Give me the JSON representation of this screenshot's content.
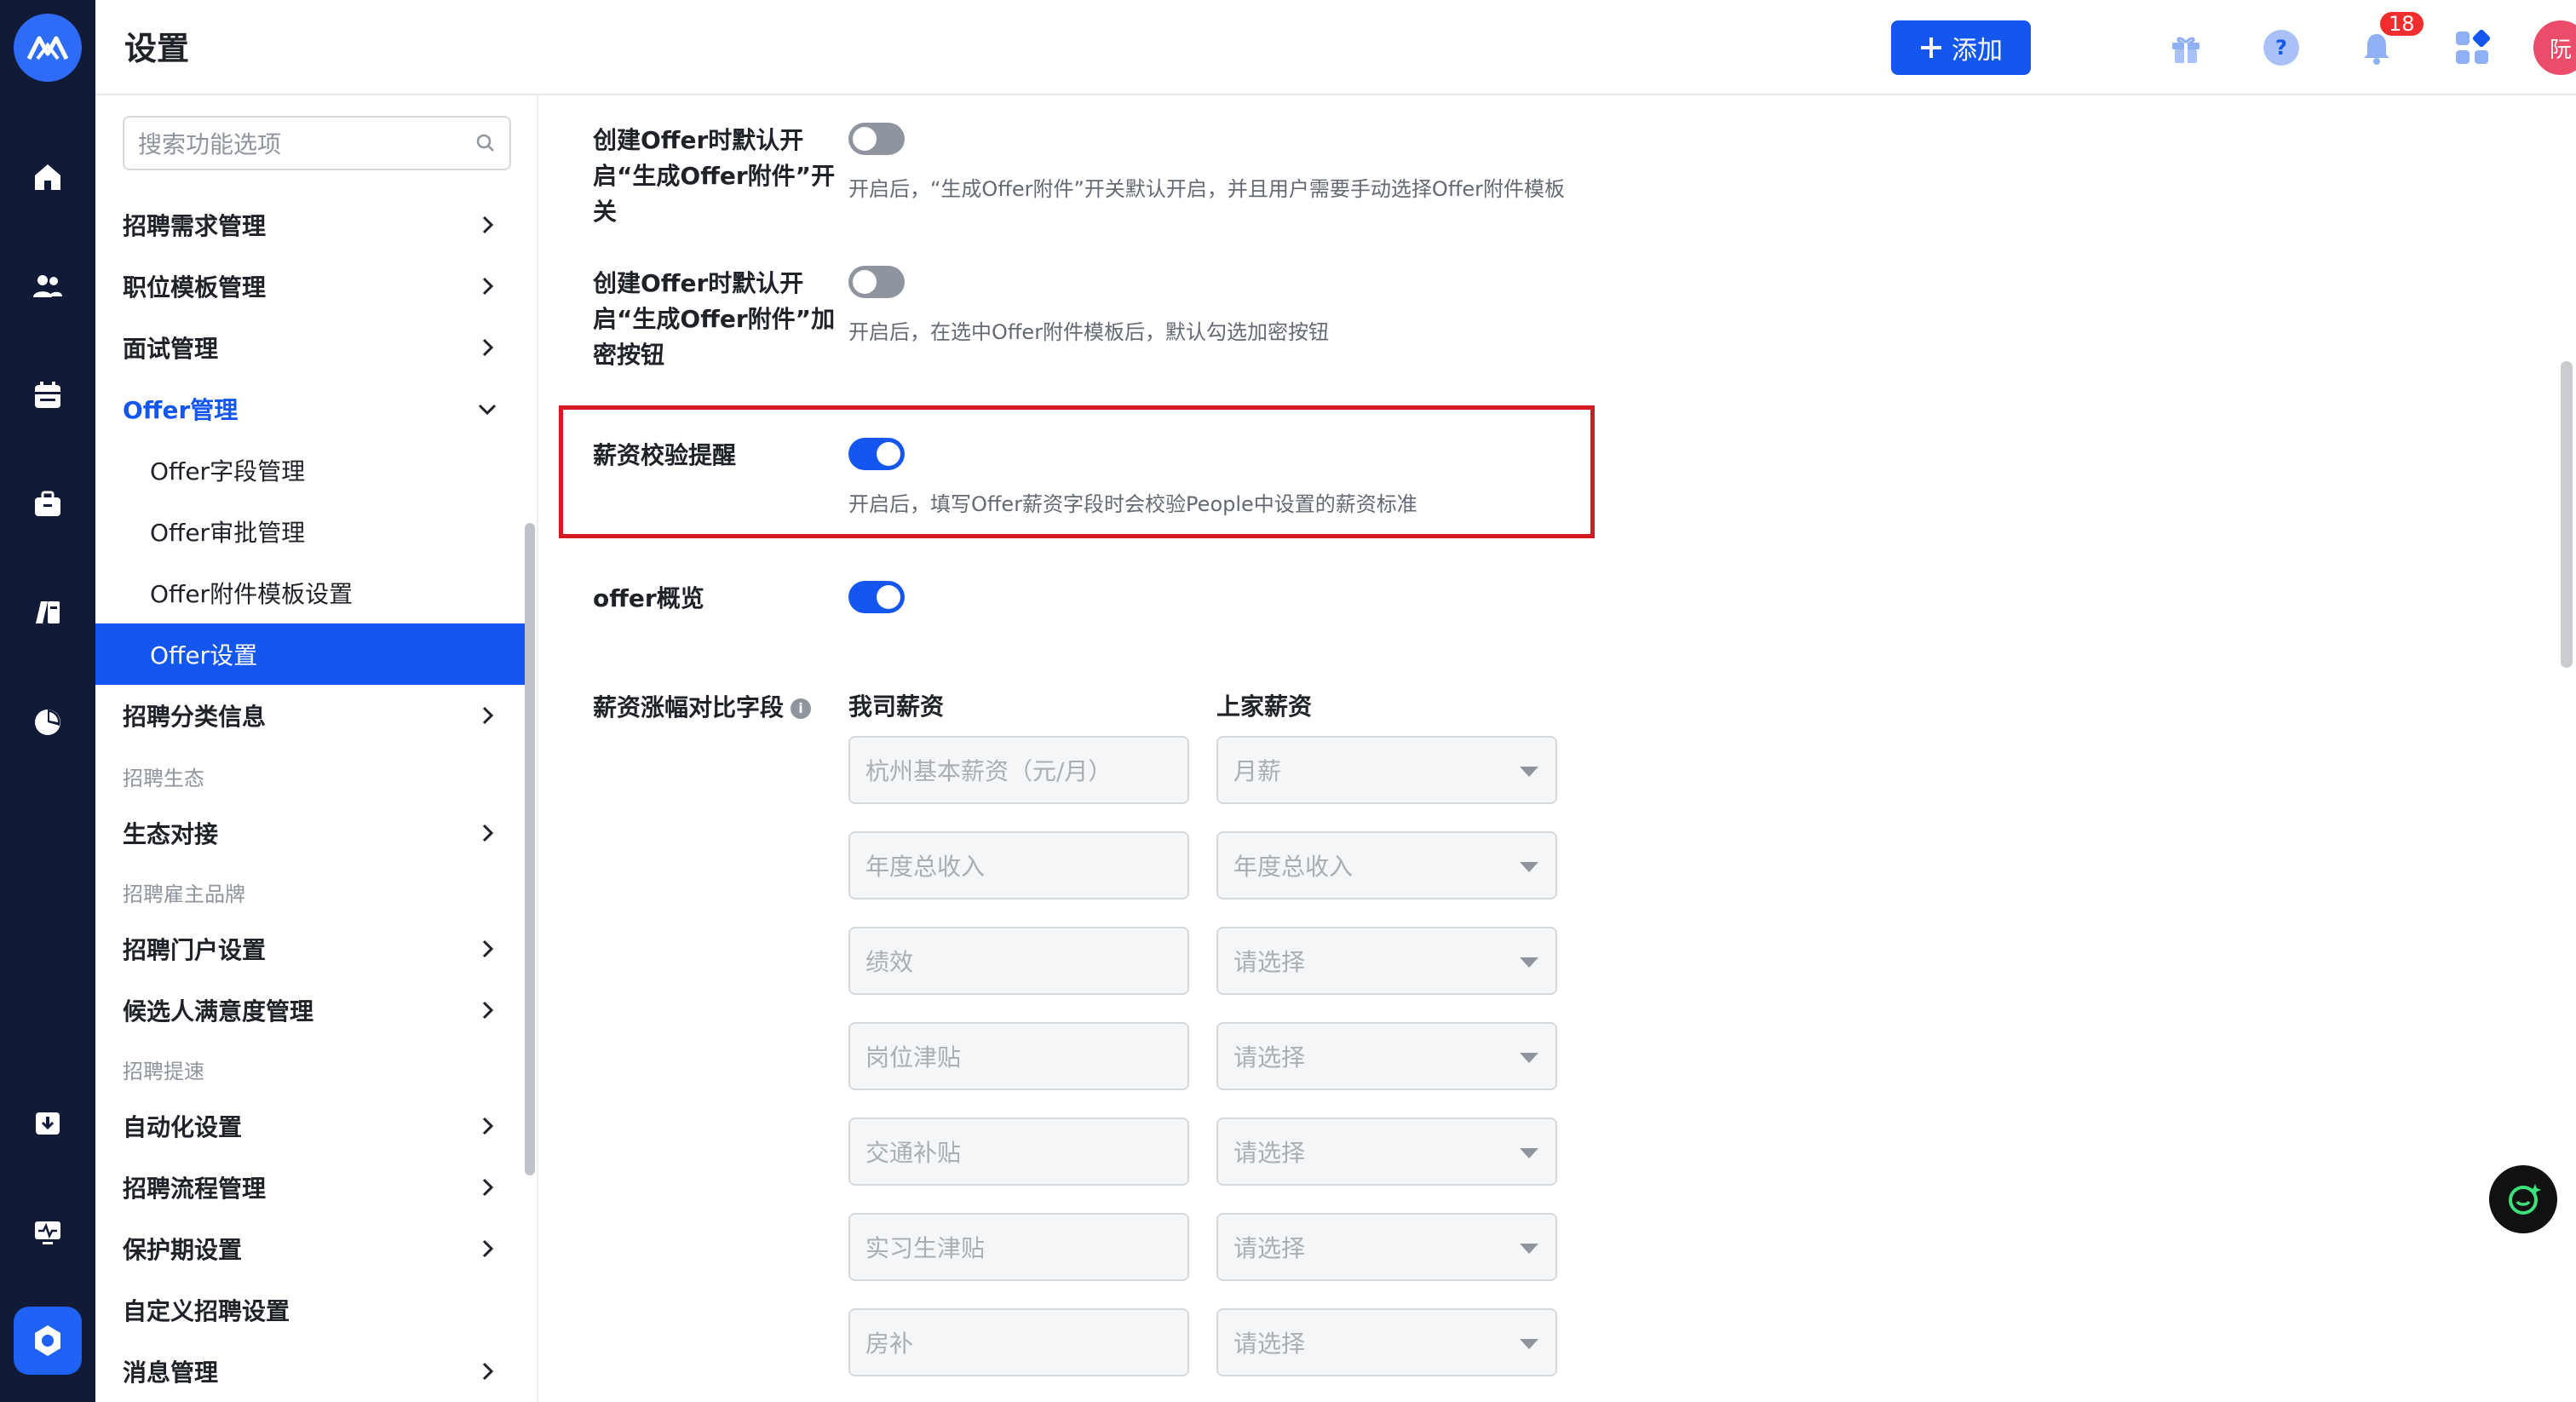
{
  "header": {
    "title": "设置",
    "add_label": "添加",
    "notification_count": "18",
    "avatar_text": "阮"
  },
  "sidebar": {
    "search_placeholder": "搜索功能选项",
    "items": [
      {
        "label": "招聘需求管理"
      },
      {
        "label": "职位模板管理"
      },
      {
        "label": "面试管理"
      },
      {
        "label": "Offer管理"
      },
      {
        "label": "Offer字段管理"
      },
      {
        "label": "Offer审批管理"
      },
      {
        "label": "Offer附件模板设置"
      },
      {
        "label": "Offer设置"
      },
      {
        "label": "招聘分类信息"
      },
      {
        "label": "招聘生态"
      },
      {
        "label": "生态对接"
      },
      {
        "label": "招聘雇主品牌"
      },
      {
        "label": "招聘门户设置"
      },
      {
        "label": "候选人满意度管理"
      },
      {
        "label": "招聘提速"
      },
      {
        "label": "自动化设置"
      },
      {
        "label": "招聘流程管理"
      },
      {
        "label": "保护期设置"
      },
      {
        "label": "自定义招聘设置"
      },
      {
        "label": "消息管理"
      }
    ]
  },
  "settings": [
    {
      "label": "创建Offer时默认开启“生成Offer附件”开关",
      "desc": "开启后，“生成Offer附件”开关默认开启，并且用户需要手动选择Offer附件模板",
      "on": false
    },
    {
      "label": "创建Offer时默认开启“生成Offer附件”加密按钮",
      "desc": "开启后，在选中Offer附件模板后，默认勾选加密按钮",
      "on": false
    },
    {
      "label": "薪资校验提醒",
      "desc": "开启后，填写Offer薪资字段时会校验People中设置的薪资标准",
      "on": true
    },
    {
      "label": "offer概览",
      "desc": "",
      "on": true
    }
  ],
  "salary_compare": {
    "label": "薪资涨幅对比字段",
    "our_col": "我司薪资",
    "prev_col": "上家薪资",
    "rows": [
      {
        "ours": "杭州基本薪资（元/月）",
        "prev": "月薪"
      },
      {
        "ours": "年度总收入",
        "prev": "年度总收入"
      },
      {
        "ours": "绩效",
        "prev": "请选择"
      },
      {
        "ours": "岗位津贴",
        "prev": "请选择"
      },
      {
        "ours": "交通补贴",
        "prev": "请选择"
      },
      {
        "ours": "实习生津贴",
        "prev": "请选择"
      },
      {
        "ours": "房补",
        "prev": "请选择"
      }
    ]
  },
  "colors": {
    "primary": "#1456f0",
    "rail": "#111a36",
    "highlight": "#d51a24"
  }
}
